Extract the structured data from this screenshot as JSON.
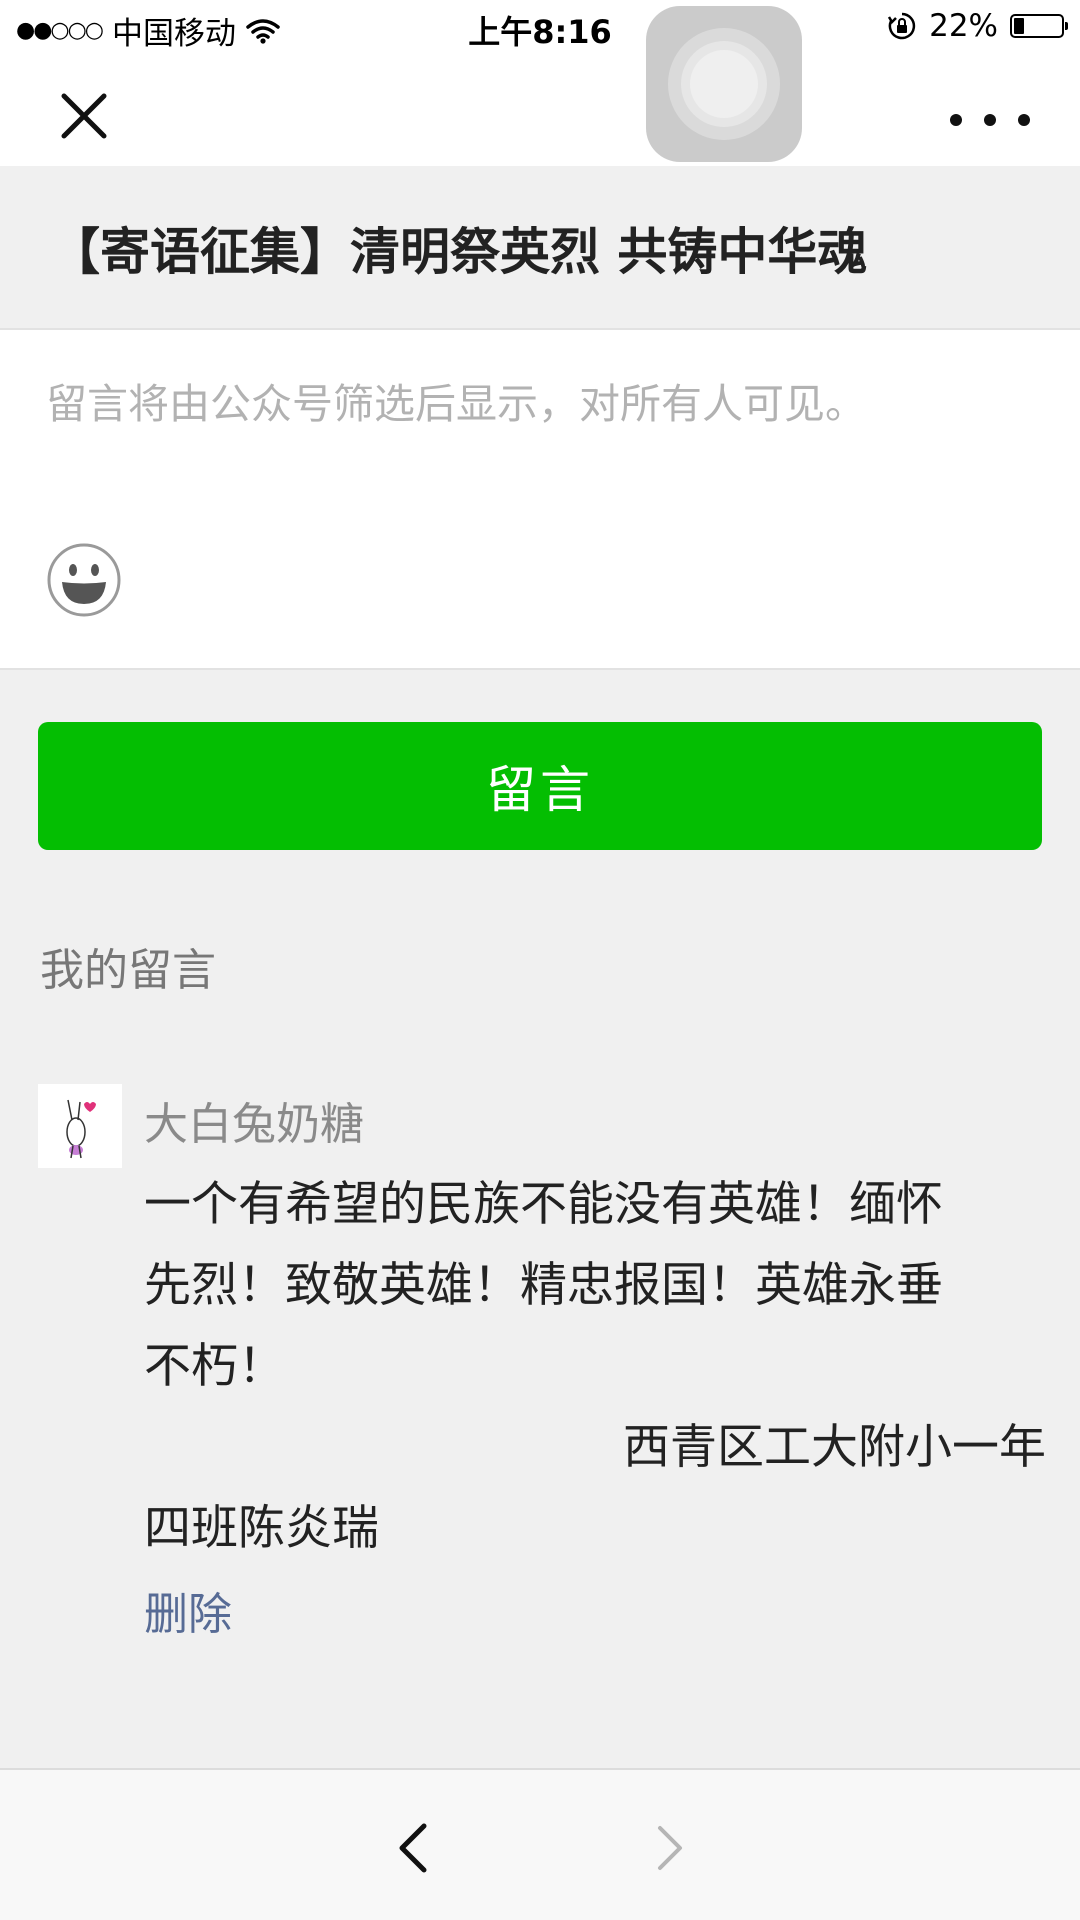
{
  "status_bar": {
    "signal": "●●○○○",
    "carrier": "中国移动",
    "time": "上午8:16",
    "battery_percent": "22%",
    "battery_level": 0.22
  },
  "nav": {
    "close_icon": "close-icon",
    "more_icon": "more-icon"
  },
  "article": {
    "title": "【寄语征集】清明祭英烈 共铸中华魂"
  },
  "comment_input": {
    "placeholder": "留言将由公众号筛选后显示，对所有人可见。",
    "emoji_icon": "smiley-icon"
  },
  "submit_label": "留言",
  "my_comments": {
    "label": "我的留言",
    "items": [
      {
        "nickname": "大白兔奶糖",
        "lines": [
          "一个有希望的民族不能没有英雄！缅怀",
          "先烈！致敬英雄！精忠报国！英雄永垂",
          "不朽！",
          "西青区工大附小一年",
          "四班陈炎瑞"
        ],
        "delete_label": "删除"
      }
    ]
  },
  "colors": {
    "accent_green": "#04be02",
    "link_blue": "#576b95",
    "background": "#f0f0f0"
  }
}
